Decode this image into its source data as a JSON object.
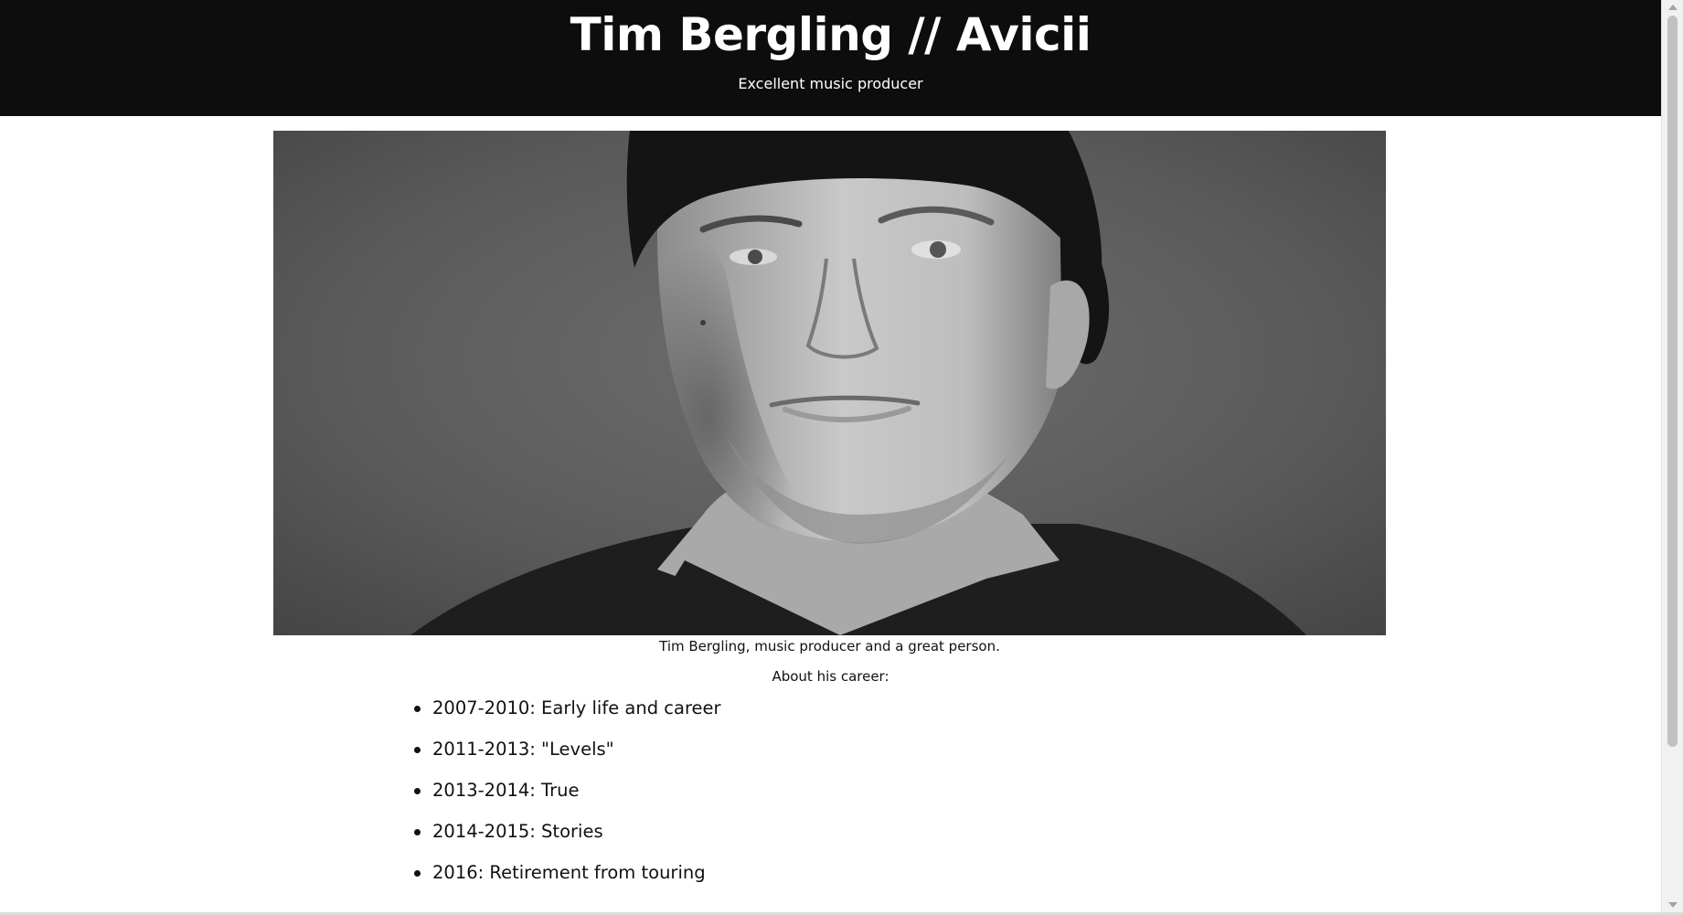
{
  "header": {
    "title": "Tim Bergling // Avicii",
    "subtitle": "Excellent music producer"
  },
  "figure": {
    "image_icon": "portrait-photo",
    "caption": "Tim Bergling, music producer and a great person."
  },
  "about_heading": "About his career:",
  "career": {
    "items": [
      "2007-2010: Early life and career",
      "2011-2013: \"Levels\"",
      "2013-2014: True",
      "2014-2015: Stories",
      "2016: Retirement from touring"
    ]
  },
  "colors": {
    "header_bg": "#0d0d0d",
    "header_text": "#ffffff",
    "body_text": "#111111"
  }
}
